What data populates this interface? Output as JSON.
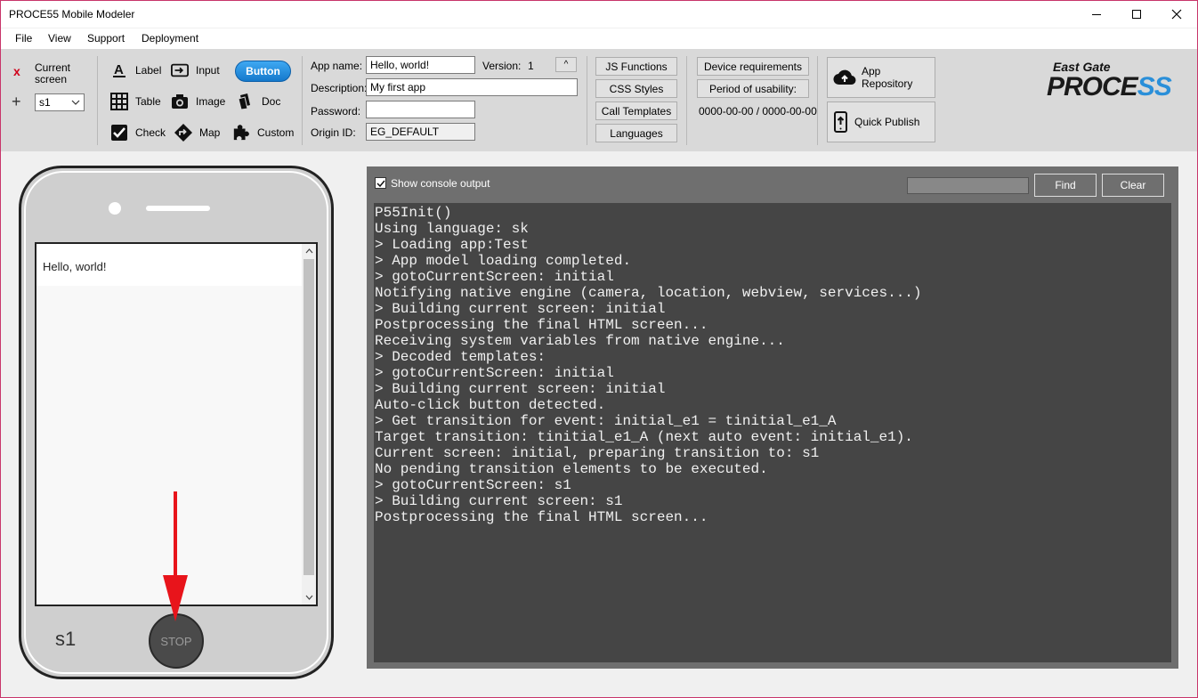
{
  "window": {
    "title": "PROCE55 Mobile Modeler"
  },
  "menu": [
    "File",
    "View",
    "Support",
    "Deployment"
  ],
  "screen_selector": {
    "remove_symbol": "x",
    "add_symbol": "+",
    "label_line1": "Current",
    "label_line2": "screen",
    "value": "s1"
  },
  "tools": {
    "label": "Label",
    "input": "Input",
    "button": "Button",
    "table": "Table",
    "image": "Image",
    "doc": "Doc",
    "check": "Check",
    "map": "Map",
    "custom": "Custom"
  },
  "app_props": {
    "app_name_label": "App name:",
    "app_name": "Hello, world!",
    "version_label": "Version:",
    "version": "1",
    "version_btn": "^",
    "description_label": "Description:",
    "description": "My first app",
    "password_label": "Password:",
    "password": "",
    "origin_label": "Origin ID:",
    "origin_id": "EG_DEFAULT"
  },
  "script_buttons": [
    "JS Functions",
    "CSS Styles",
    "Call Templates",
    "Languages"
  ],
  "device": {
    "requirements": "Device requirements",
    "usability": "Period of usability:",
    "period": "0000-00-00 / 0000-00-00"
  },
  "publish": {
    "repository": "App Repository",
    "quick_publish": "Quick Publish"
  },
  "logo": {
    "top": "East Gate",
    "main_a": "PROCE",
    "main_b": "SS"
  },
  "phone": {
    "content_text": "Hello, world!",
    "screen_name": "s1",
    "stop_label": "STOP"
  },
  "console": {
    "show_label": "Show console output",
    "find_label": "Find",
    "clear_label": "Clear",
    "lines": [
      "P55Init()",
      "Using language: sk",
      "> Loading app:Test",
      "> App model loading completed.",
      "> gotoCurrentScreen: initial",
      "Notifying native engine (camera, location, webview, services...)",
      "> Building current screen: initial",
      "Postprocessing the final HTML screen...",
      "Receiving system variables from native engine...",
      "> Decoded templates:",
      "> gotoCurrentScreen: initial",
      "> Building current screen: initial",
      "Auto-click button detected.",
      "> Get transition for event: initial_e1 = tinitial_e1_A",
      "Target transition: tinitial_e1_A (next auto event: initial_e1).",
      "Current screen: initial, preparing transition to: s1",
      "No pending transition elements to be executed.",
      "> gotoCurrentScreen: s1",
      "> Building current screen: s1",
      "Postprocessing the final HTML screen..."
    ]
  },
  "colors": {
    "accent": "#1e88e5",
    "annotation_arrow": "#e8141b",
    "remove_red": "#d0021b"
  }
}
